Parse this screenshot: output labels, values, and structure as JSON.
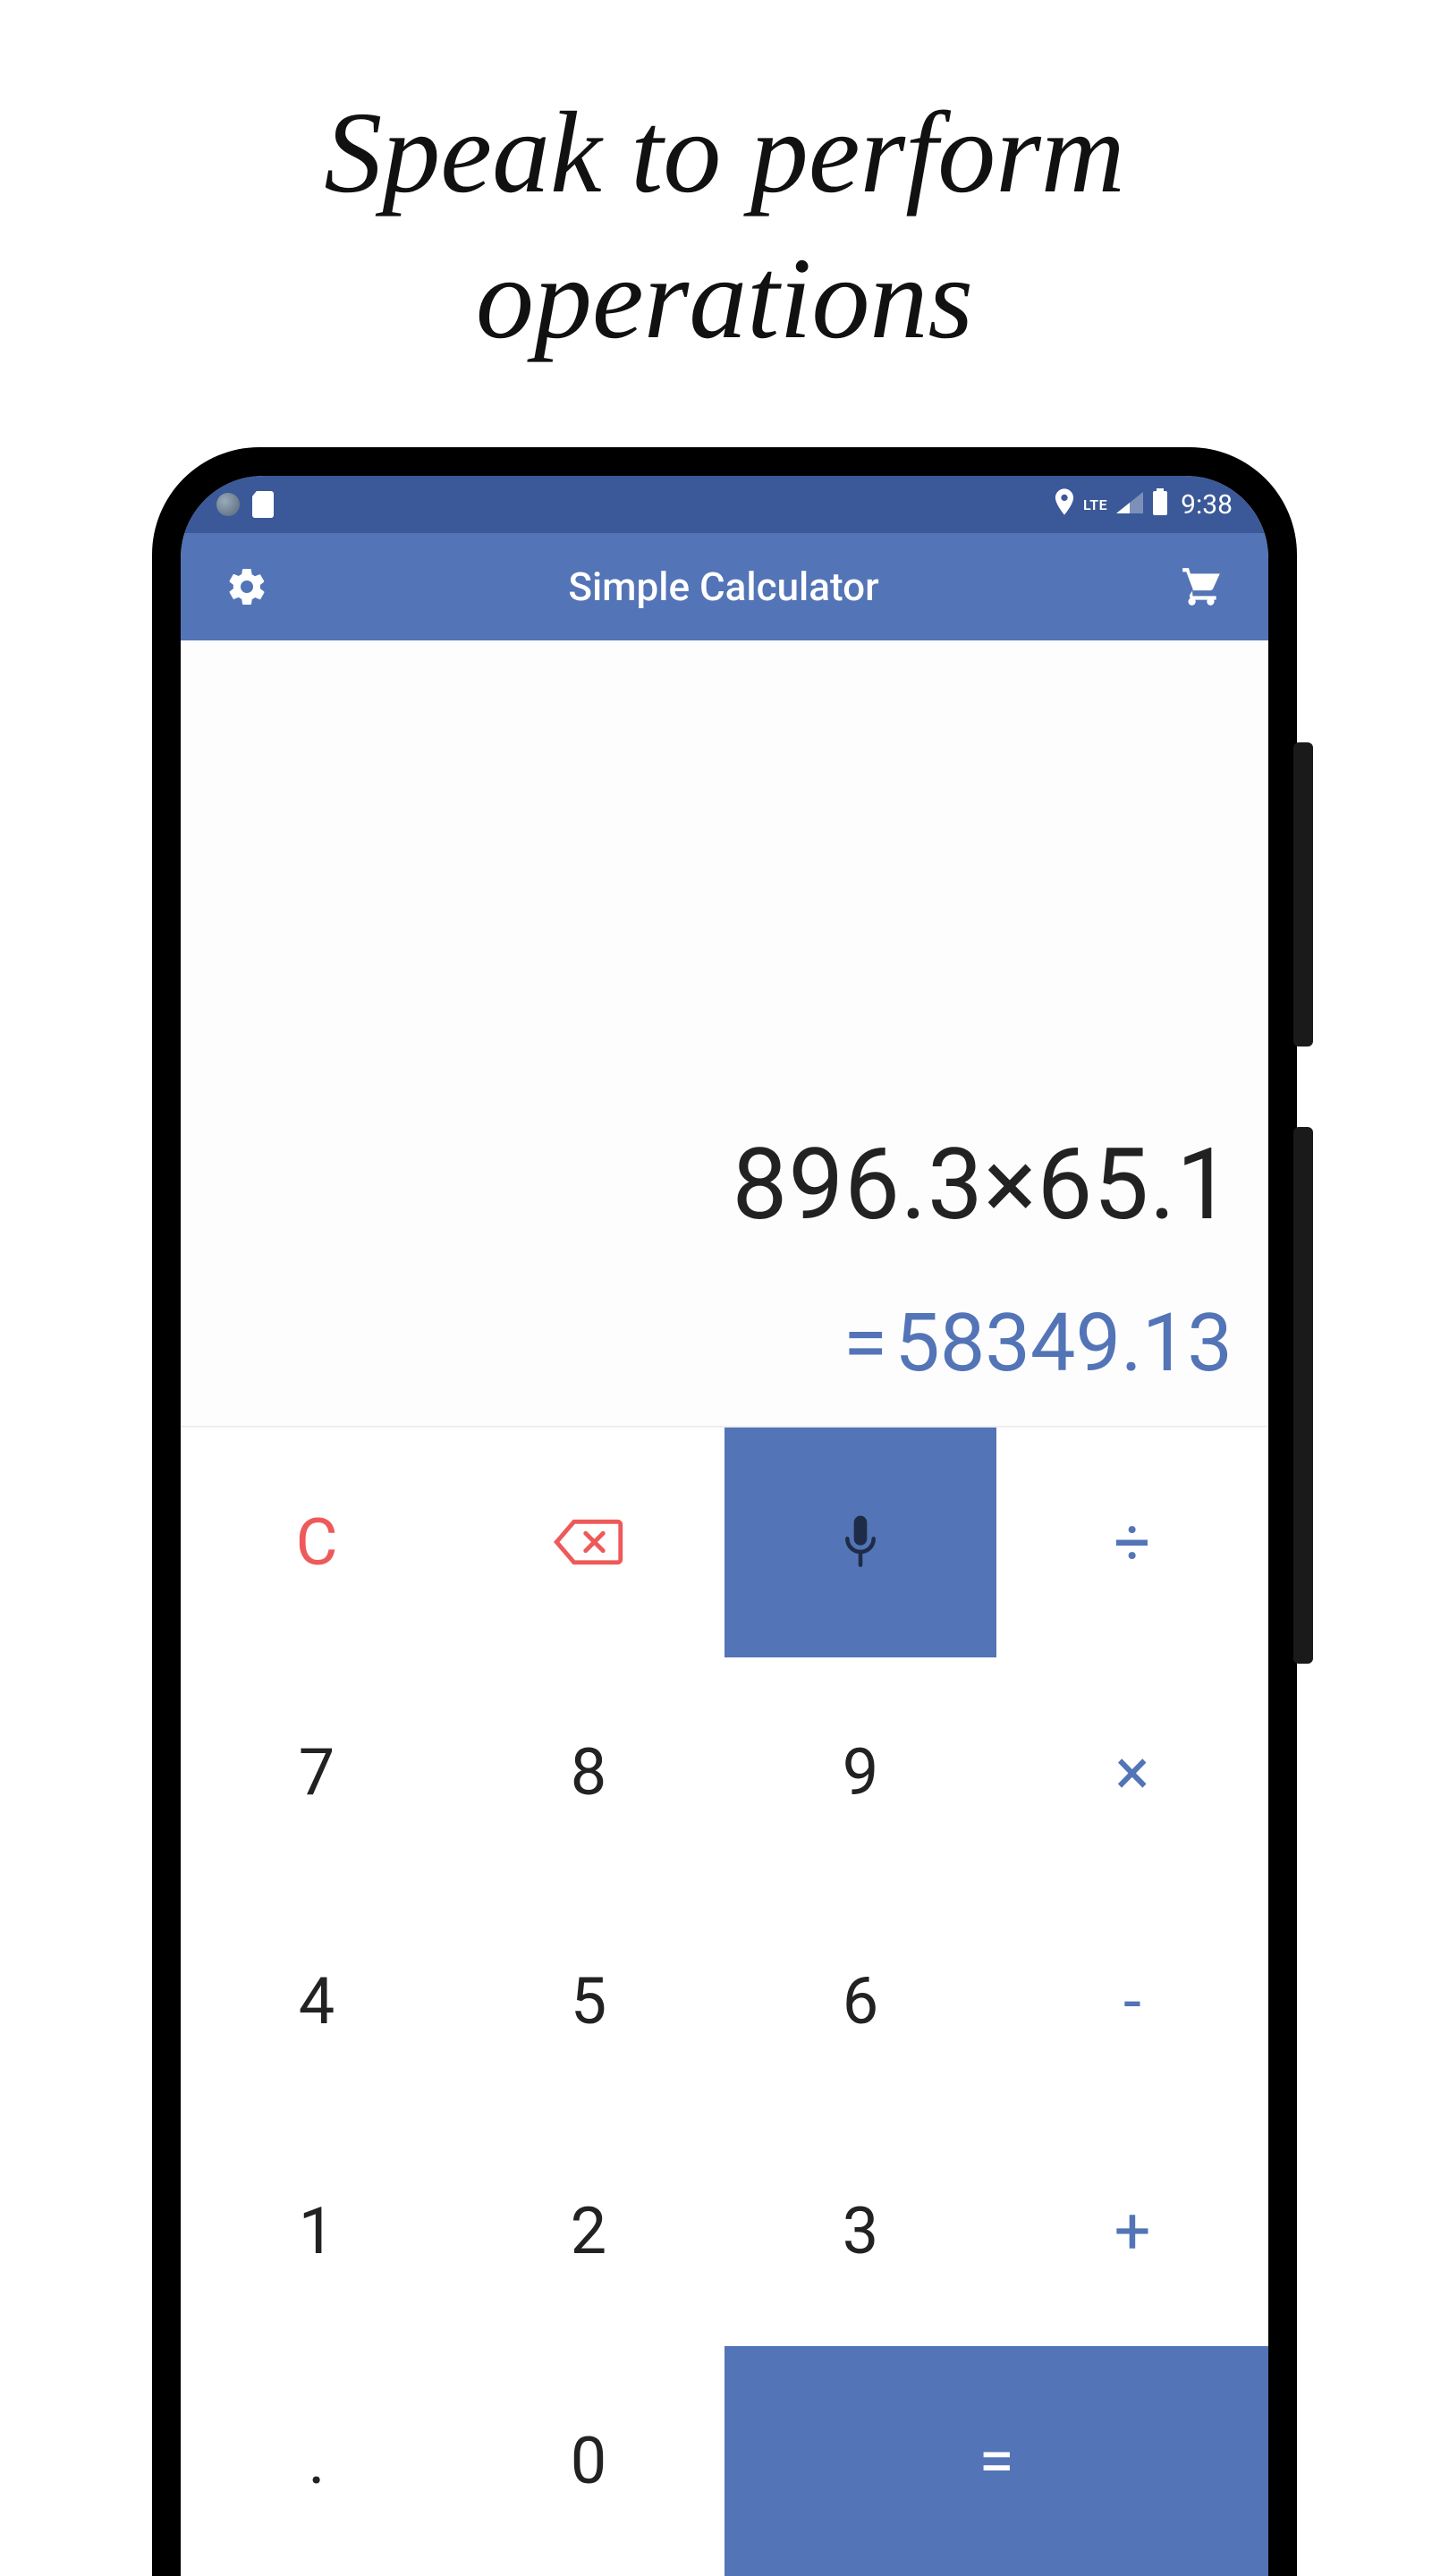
{
  "promo": {
    "line1": "Speak to perform",
    "line2": "operations"
  },
  "status": {
    "lte": "LTE",
    "time": "9:38"
  },
  "app": {
    "title": "Simple Calculator"
  },
  "display": {
    "expression": "896.3×65.1",
    "result_prefix": "=",
    "result_value": "58349.13"
  },
  "keys": {
    "clear": "C",
    "divide": "÷",
    "k7": "7",
    "k8": "8",
    "k9": "9",
    "multiply": "×",
    "k4": "4",
    "k5": "5",
    "k6": "6",
    "minus": "-",
    "k1": "1",
    "k2": "2",
    "k3": "3",
    "plus": "+",
    "dot": ".",
    "k0": "0",
    "equals": "="
  }
}
